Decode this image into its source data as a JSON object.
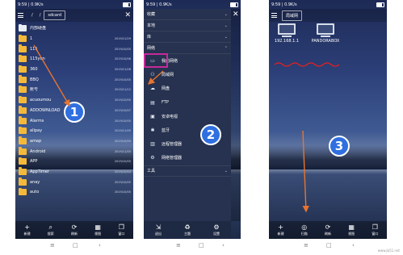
{
  "status": {
    "time_speed": "9:59 | 0.9K/s",
    "battery": "■■"
  },
  "panel1": {
    "crumbs": [
      "/",
      "/",
      "sdcard"
    ],
    "files": [
      {
        "name": "内部硬盘",
        "sub": "",
        "meta": "",
        "date": "",
        "type": "file"
      },
      {
        "name": "1",
        "sub": "",
        "meta": "",
        "date": "2019/11/29",
        "type": "folder"
      },
      {
        "name": "115",
        "sub": "",
        "meta": "",
        "date": "2019/10/05",
        "type": "folder"
      },
      {
        "name": "115yun",
        "sub": "",
        "meta": "",
        "date": "2019/10/06",
        "type": "folder"
      },
      {
        "name": "360",
        "sub": "",
        "meta": "",
        "date": "2019/11/26",
        "type": "folder"
      },
      {
        "name": "BBQ",
        "sub": "",
        "meta": "",
        "date": "2019/10/05",
        "type": "folder"
      },
      {
        "name": "账号",
        "sub": "",
        "meta": "",
        "date": "2019/11/12",
        "type": "folder"
      },
      {
        "name": "acuoumou",
        "sub": "",
        "meta": "",
        "date": "2019/10/05",
        "type": "folder"
      },
      {
        "name": "ADDOWNLOAD",
        "sub": "",
        "meta": "",
        "date": "2019/10/07",
        "type": "folder"
      },
      {
        "name": "Alarms",
        "sub": "",
        "meta": "",
        "date": "2019/10/05",
        "type": "folder"
      },
      {
        "name": "alipay",
        "sub": "",
        "meta": "",
        "date": "2019/11/05",
        "type": "folder"
      },
      {
        "name": "amap",
        "sub": "",
        "meta": "",
        "date": "2019/10/05",
        "type": "folder"
      },
      {
        "name": "Android",
        "sub": "",
        "meta": "",
        "date": "2019/11/05",
        "type": "folder"
      },
      {
        "name": "APP",
        "sub": "",
        "meta": "",
        "date": "2019/10/05",
        "type": "folder"
      },
      {
        "name": "AppTimer",
        "sub": "",
        "meta": "",
        "date": "2019/10/04",
        "type": "folder"
      },
      {
        "name": "anay",
        "sub": "",
        "meta": "",
        "date": "2019/10/05",
        "type": "folder"
      },
      {
        "name": "auto",
        "sub": "",
        "meta": "",
        "date": "2019/10/05",
        "type": "folder"
      }
    ],
    "bottom": [
      {
        "icon": "+",
        "label": "新建"
      },
      {
        "icon": "⌕",
        "label": "搜索"
      },
      {
        "icon": "⟳",
        "label": "刷新"
      },
      {
        "icon": "▦",
        "label": "视图"
      },
      {
        "icon": "❐",
        "label": "窗口"
      }
    ],
    "badge": "1"
  },
  "panel2": {
    "sections": [
      {
        "label": "收藏",
        "chev": "⌄"
      },
      {
        "label": "本地",
        "chev": "⌄"
      },
      {
        "label": "库",
        "chev": "⌄"
      },
      {
        "label": "网络",
        "chev": "⌃"
      }
    ],
    "items": [
      {
        "icon": "▭",
        "label": "我的网络"
      },
      {
        "icon": "⚇",
        "label": "局域网"
      },
      {
        "icon": "☁",
        "label": "网盘"
      },
      {
        "icon": "▤",
        "label": "FTP"
      },
      {
        "icon": "▣",
        "label": "安卓电视"
      },
      {
        "icon": "✱",
        "label": "蓝牙"
      },
      {
        "icon": "▥",
        "label": "远程管理器"
      },
      {
        "icon": "⚙",
        "label": "网络管理器"
      }
    ],
    "tools": {
      "label": "工具",
      "chev": "⌄"
    },
    "bottom": [
      {
        "icon": "⇲",
        "label": "退出"
      },
      {
        "icon": "♻",
        "label": "主题"
      },
      {
        "icon": "⚙",
        "label": "设置"
      }
    ],
    "close": "✕",
    "badge": "2"
  },
  "panel3": {
    "title": "局域网",
    "devices": [
      {
        "label": "192.168.1.1"
      },
      {
        "label": "PANDORABOX"
      }
    ],
    "bottom": [
      {
        "icon": "+",
        "label": "新建"
      },
      {
        "icon": "◎",
        "label": "扫描"
      },
      {
        "icon": "⟳",
        "label": "刷新"
      },
      {
        "icon": "▦",
        "label": "视图"
      },
      {
        "icon": "❐",
        "label": "窗口"
      }
    ],
    "badge": "3"
  },
  "nav": {
    "menu": "≡",
    "home": "□",
    "back": "‹"
  },
  "watermark": "www.jb51.net",
  "colors": {
    "highlight": "#c72a9a",
    "badge": "#2f6fe0",
    "arrow": "#e8742f",
    "scribble": "#e02020"
  }
}
